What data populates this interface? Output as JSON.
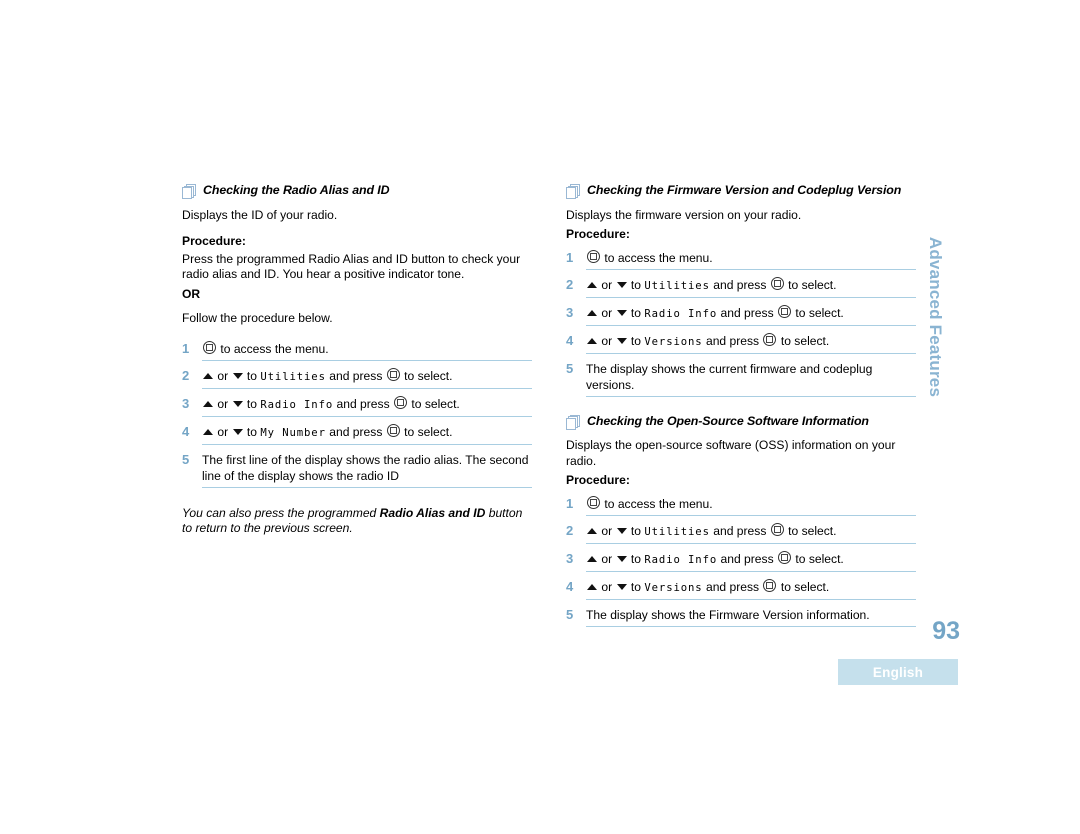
{
  "page": {
    "number": "93",
    "language_badge": "English",
    "side_tab": "Advanced Features"
  },
  "left_column": {
    "heading": "Checking the Radio Alias and ID",
    "intro": "Displays the ID of your radio.",
    "procedure_label": "Procedure:",
    "press_text": "Press the programmed Radio Alias and ID button to check your radio alias and ID. You hear a positive indicator tone.",
    "or_label": "OR",
    "follow_text": "Follow the procedure below.",
    "steps": [
      {
        "num": "1",
        "pre": "",
        "menu": "",
        "post": "to access the menu.",
        "type": "button-only"
      },
      {
        "num": "2",
        "pre": "or",
        "menu": "Utilities",
        "post": "to select.",
        "type": "navigate"
      },
      {
        "num": "3",
        "pre": "or",
        "menu": "Radio Info",
        "post": "to select.",
        "type": "navigate"
      },
      {
        "num": "4",
        "pre": "or",
        "menu": "My Number",
        "post": "to select.",
        "type": "navigate"
      },
      {
        "num": "5",
        "text": "The first line of the display shows the radio alias. The second line of the display shows the radio ID",
        "type": "text"
      }
    ],
    "note_before": "You can also press the programmed ",
    "note_bold": "Radio Alias and ID",
    "note_after": " button to return to the previous screen."
  },
  "right_column": {
    "section_one": {
      "heading": "Checking the Firmware Version and Codeplug Version",
      "intro": "Displays the firmware version on your radio.",
      "procedure_label": "Procedure:",
      "steps": [
        {
          "num": "1",
          "post": "to access the menu.",
          "type": "button-only"
        },
        {
          "num": "2",
          "pre": "or",
          "menu": "Utilities",
          "post": "to select.",
          "type": "navigate"
        },
        {
          "num": "3",
          "pre": "or",
          "menu": "Radio Info",
          "post": "to select.",
          "type": "navigate"
        },
        {
          "num": "4",
          "pre": "or",
          "menu": "Versions",
          "post": "to select.",
          "type": "navigate"
        },
        {
          "num": "5",
          "text": "The display shows the current firmware and codeplug versions.",
          "type": "text"
        }
      ]
    },
    "section_two": {
      "heading": "Checking the Open-Source Software Information",
      "intro": "Displays the open-source software (OSS) information on your radio.",
      "procedure_label": "Procedure:",
      "steps": [
        {
          "num": "1",
          "post": "to access the menu.",
          "type": "button-only"
        },
        {
          "num": "2",
          "pre": "or",
          "menu": "Utilities",
          "post": "to select.",
          "type": "navigate"
        },
        {
          "num": "3",
          "pre": "or",
          "menu": "Radio Info",
          "post": "to select.",
          "type": "navigate"
        },
        {
          "num": "4",
          "pre": "or",
          "menu": "Versions",
          "post": "to select.",
          "type": "navigate"
        },
        {
          "num": "5",
          "text": "The display shows the Firmware Version information.",
          "type": "text"
        }
      ]
    }
  },
  "glyph_labels": {
    "menu_button": "menu-select-button",
    "up_arrow": "up-arrow",
    "down_arrow": "down-arrow",
    "and_press": "and press",
    "to_word": "to"
  },
  "colors": {
    "accent_blue": "#74a5c6",
    "rule_blue": "#a9cee2",
    "badge_bg": "#c5e0ec",
    "side_tab": "#8ab4d2"
  }
}
